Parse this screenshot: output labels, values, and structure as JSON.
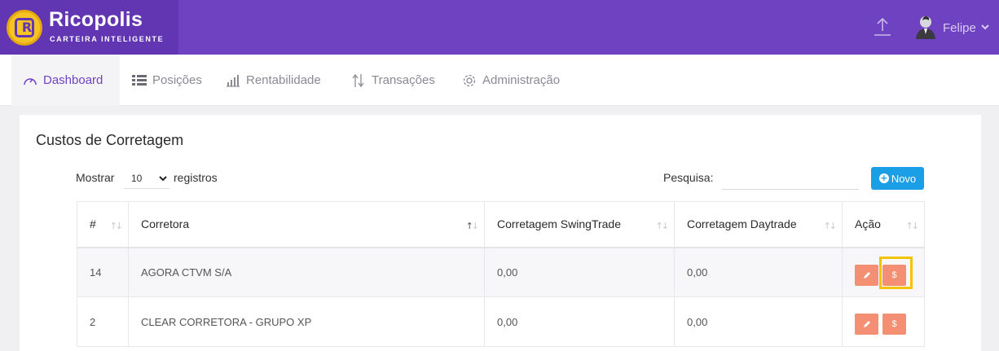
{
  "brand": {
    "title": "Ricopolis",
    "subtitle": "CARTEIRA INTELIGENTE",
    "logo_letter": "R",
    "primary": "#6f42c1",
    "accent": "#f6c324"
  },
  "header": {
    "user_name": "Felipe",
    "upload_icon": "upload-icon",
    "avatar_icon": "user-avatar-icon"
  },
  "nav": {
    "items": [
      {
        "label": "Dashboard",
        "icon": "gauge-icon",
        "active": true
      },
      {
        "label": "Posições",
        "icon": "table-list-icon",
        "active": false
      },
      {
        "label": "Rentabilidade",
        "icon": "bar-chart-icon",
        "active": false
      },
      {
        "label": "Transações",
        "icon": "transfer-arrows-icon",
        "active": false
      },
      {
        "label": "Administração",
        "icon": "gear-icon",
        "active": false
      }
    ]
  },
  "card": {
    "title": "Custos de Corretagem"
  },
  "controls": {
    "show_label": "Mostrar",
    "page_length": "10",
    "records_label": "registros",
    "search_label": "Pesquisa:",
    "search_value": "",
    "new_button": "Novo"
  },
  "table": {
    "columns": [
      "#",
      "Corretora",
      "Corretagem SwingTrade",
      "Corretagem Daytrade",
      "Ação"
    ],
    "rows": [
      {
        "id": "14",
        "broker": "AGORA CTVM S/A",
        "swing": "0,00",
        "day": "0,00"
      },
      {
        "id": "2",
        "broker": "CLEAR CORRETORA - GRUPO XP",
        "swing": "0,00",
        "day": "0,00"
      }
    ],
    "action_edit_icon": "pencil-icon",
    "action_cost_label": "$",
    "action_color": "#f48f73"
  },
  "highlight_color": "#f2c300"
}
